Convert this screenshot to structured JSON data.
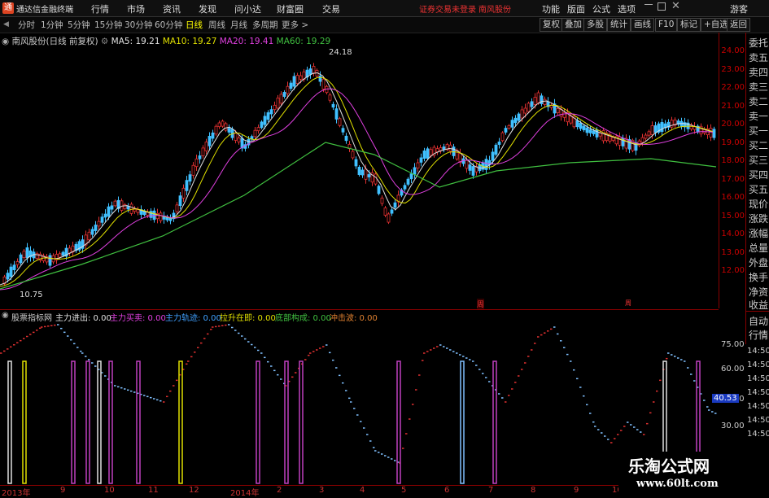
{
  "titlebar": {
    "app_name": "通达信金融终端",
    "menus": [
      "行情",
      "市场",
      "资讯",
      "发现",
      "问小达",
      "财富圈",
      "交易"
    ],
    "warning": "证券交易未登录",
    "stock_name": "南风股份",
    "right_menus": [
      "功能",
      "版面",
      "公式",
      "选项"
    ],
    "guest": "游客"
  },
  "toolbar": {
    "periods": [
      "分时",
      "1分钟",
      "5分钟",
      "15分钟",
      "30分钟",
      "60分钟",
      "日线",
      "周线",
      "月线",
      "多周期",
      "更多 >"
    ],
    "active_period": "日线",
    "right_buttons": [
      "复权",
      "叠加",
      "多股",
      "统计",
      "画线",
      "F10",
      "标记",
      "+自选",
      "返回"
    ]
  },
  "chart": {
    "stock_label": "南风股份(日线 前复权)",
    "ma": [
      {
        "label": "MA5: 19.21",
        "color": "#e0e0e0"
      },
      {
        "label": "MA10: 19.27",
        "color": "#e0e000"
      },
      {
        "label": "MA20: 19.41",
        "color": "#e040e0"
      },
      {
        "label": "MA60: 19.29",
        "color": "#40c040"
      }
    ],
    "high_label": "24.18",
    "low_label": "10.75",
    "y_ticks": [
      "24.00",
      "23.00",
      "22.00",
      "21.00",
      "20.00",
      "19.00",
      "18.00",
      "17.00",
      "16.00",
      "15.00",
      "14.00",
      "13.00",
      "12.00"
    ],
    "marker1": "周",
    "marker2": "周"
  },
  "side_panel": [
    "委托",
    "卖五",
    "卖四",
    "卖三",
    "卖二",
    "卖一",
    "买一",
    "买二",
    "买三",
    "买四",
    "买五",
    "现价",
    "涨跌",
    "涨幅",
    "总量",
    "外盘",
    "换手",
    "净资",
    "收益"
  ],
  "side_panel_lower": [
    "自动",
    "行情"
  ],
  "indicator": {
    "name": "股票指标网",
    "items": [
      {
        "label": "主力进出: 0.00",
        "color": "#e0e0e0"
      },
      {
        "label": "主力买卖: 0.00",
        "color": "#e040e0"
      },
      {
        "label": "主力轨迹: 0.00",
        "color": "#40a0ff"
      },
      {
        "label": "拉升在即: 0.00",
        "color": "#e0e000"
      },
      {
        "label": "底部构成: 0.00",
        "color": "#40c040"
      },
      {
        "label": "冲击波: 0.00",
        "color": "#e08030"
      }
    ],
    "y_ticks": [
      "75.00",
      "60.00",
      "45.00",
      "30.00"
    ],
    "right_tags": [
      "14:50",
      "14:50",
      "14:50",
      "14:50",
      "14:50",
      "14:50",
      "14:50"
    ],
    "current_value": "40.53"
  },
  "date_axis": [
    "2013年",
    "9",
    "10",
    "11",
    "12",
    "2014年",
    "2",
    "3",
    "4",
    "5",
    "6",
    "7",
    "8",
    "9",
    "10"
  ],
  "watermark": {
    "title": "乐淘公式网",
    "url": "www.60lt.com"
  },
  "colors": {
    "up": "#e03030",
    "down": "#40c0ff",
    "border": "#800000"
  }
}
